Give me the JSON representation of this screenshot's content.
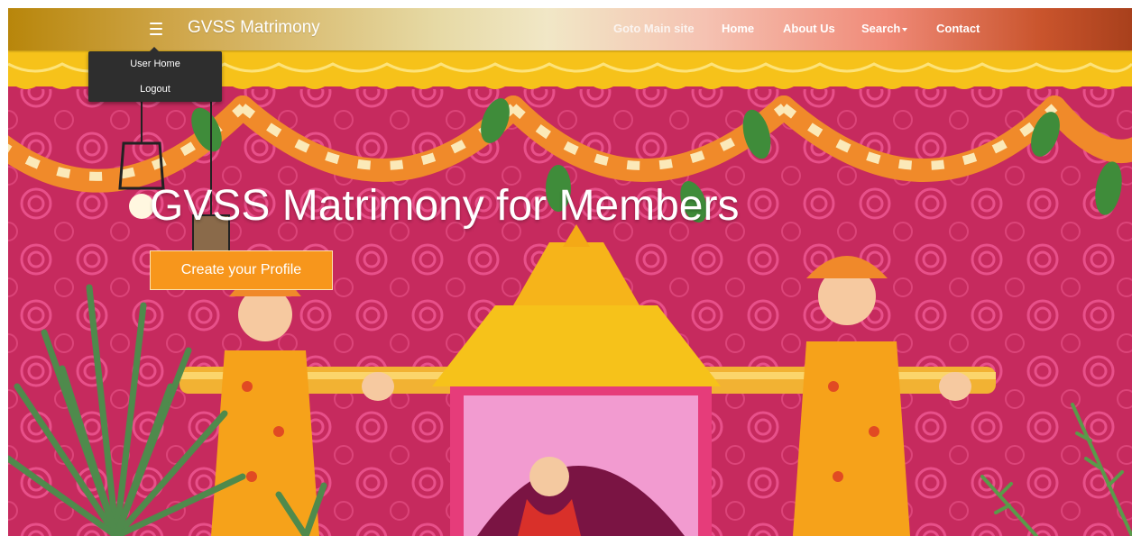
{
  "navbar": {
    "menu_icon": "hamburger-menu-icon",
    "brand": "GVSS Matrimony",
    "links": [
      {
        "label": "Goto Main site"
      },
      {
        "label": "Home"
      },
      {
        "label": "About Us"
      },
      {
        "label": "Search"
      },
      {
        "label": "Contact"
      }
    ]
  },
  "dropdown": {
    "items": [
      {
        "label": "User Home"
      },
      {
        "label": "Logout"
      }
    ]
  },
  "hero": {
    "title": "GVSS Matrimony for Members",
    "cta_label": "Create your Profile"
  },
  "colors": {
    "cta": "#f7961c",
    "banner_magenta": "#c62a5e",
    "banner_yellow": "#f6c21a",
    "dropdown_bg": "#2e2e2e"
  }
}
